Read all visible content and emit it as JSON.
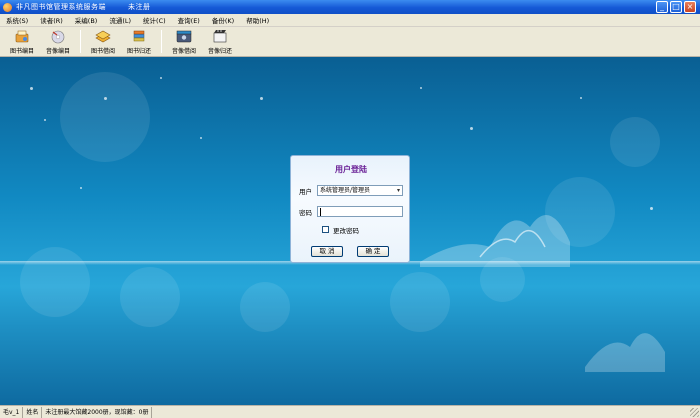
{
  "window": {
    "title": "非凡图书馆管理系统服务端",
    "registration": "未注册",
    "controls": [
      "_",
      "□",
      "×"
    ]
  },
  "menu": [
    {
      "label": "系统(S)"
    },
    {
      "label": "读者(R)"
    },
    {
      "label": "采编(B)"
    },
    {
      "label": "流通(L)"
    },
    {
      "label": "统计(C)"
    },
    {
      "label": "查询(E)"
    },
    {
      "label": "备份(K)"
    },
    {
      "label": "帮助(H)"
    }
  ],
  "toolbar": [
    {
      "label": "图书编目",
      "icon": "book-catalog-icon"
    },
    {
      "label": "音像编目",
      "icon": "audio-video-catalog-icon"
    },
    {
      "label": "图书借阅",
      "icon": "book-borrow-icon"
    },
    {
      "label": "图书归还",
      "icon": "book-return-icon"
    },
    {
      "label": "音像借阅",
      "icon": "audio-video-borrow-icon"
    },
    {
      "label": "音像归还",
      "icon": "audio-video-return-icon"
    }
  ],
  "login": {
    "title": "用户登陆",
    "user_label": "用户",
    "user_value": "系统管理员/管理员",
    "password_label": "密码",
    "password_value": "",
    "change_password_label": "更改密码",
    "change_password_checked": false,
    "cancel_label": "取 消",
    "ok_label": "确 定"
  },
  "status": {
    "user": "毛v_1",
    "name": "姓名",
    "info": "未注册最大馆藏2000册，现馆藏：0册"
  },
  "colors": {
    "title_bar": "#1559d6",
    "dialog_title": "#6a2096",
    "background": "#1189c2"
  }
}
